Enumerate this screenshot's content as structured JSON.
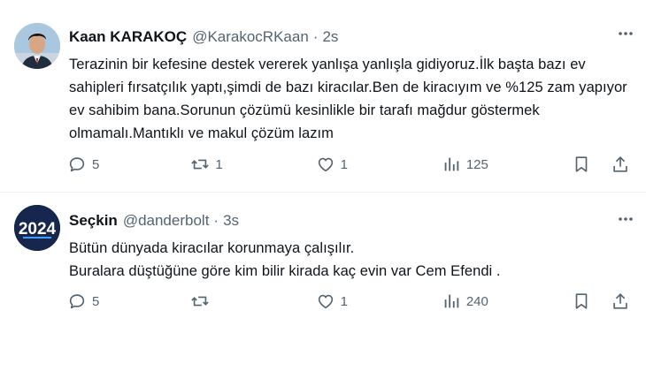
{
  "tweets": [
    {
      "name": "Kaan KARAKOÇ",
      "handle": "@KarakocRKaan",
      "dot": "·",
      "time": "2s",
      "text": "Terazinin bir kefesine destek vererek yanlışa yanlışla gidiyoruz.İlk başta bazı ev sahipleri fırsatçılık yaptı,şimdi de bazı kiracılar.Ben de kiracıyım ve %125 zam yapıyor ev sahibim bana.Sorunun çözümü kesinlikle bir tarafı mağdur göstermek olmamalı.Mantıklı ve makul çözüm lazım",
      "replies": "5",
      "retweets": "1",
      "likes": "1",
      "views": "125"
    },
    {
      "name": "Seçkin",
      "handle": "@danderbolt",
      "dot": "·",
      "time": "3s",
      "text": "Bütün dünyada kiracılar korunmaya çalışılır.\nBuralara düştüğüne göre kim bilir kirada kaç evin var Cem Efendi .",
      "avatar_text": "2024",
      "replies": "5",
      "retweets": "",
      "likes": "1",
      "views": "240"
    }
  ],
  "icons": [
    "more-icon",
    "reply-icon",
    "retweet-icon",
    "like-icon",
    "views-icon",
    "bookmark-icon",
    "share-icon"
  ],
  "colors": {
    "secondary_text": "#536471",
    "divider": "#eff3f4",
    "avatar2_bg": "#16264d"
  }
}
